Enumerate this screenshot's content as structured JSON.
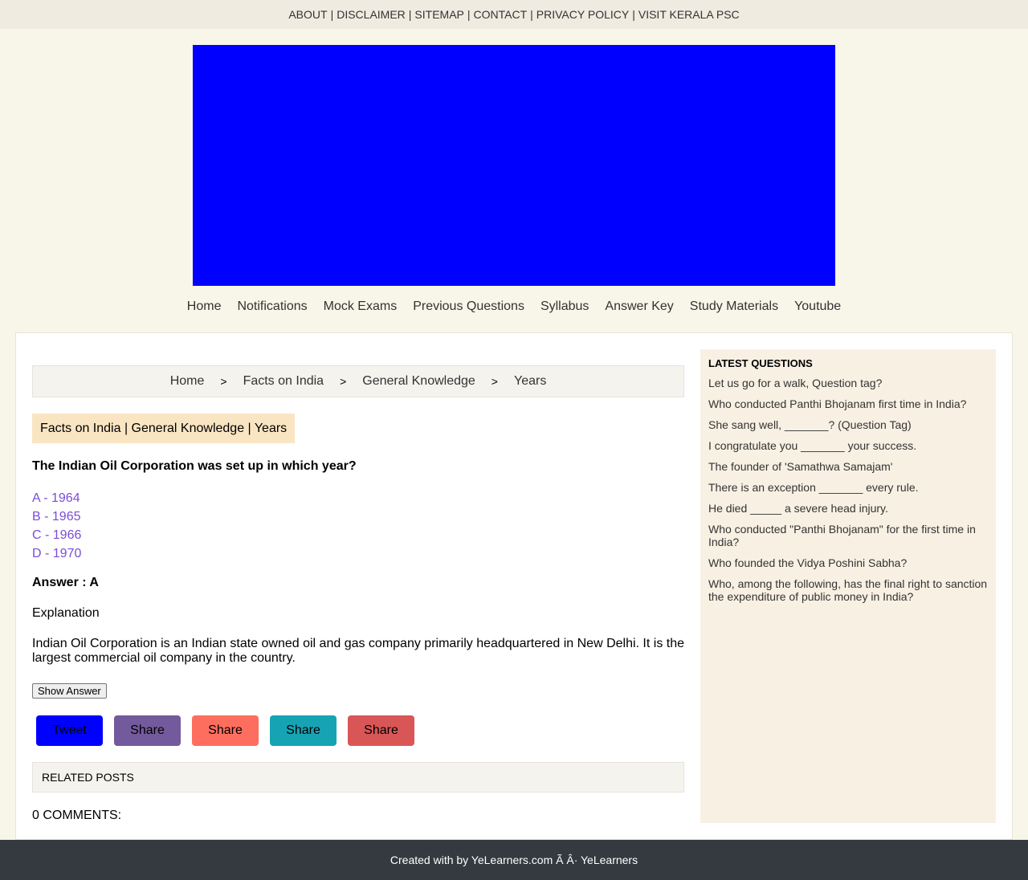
{
  "topbar": {
    "links": [
      "ABOUT",
      "DISCLAIMER",
      "SITEMAP",
      "CONTACT",
      "PRIVACY POLICY",
      "VISIT KERALA PSC"
    ],
    "separator": "|"
  },
  "banner": {
    "color": "#0000ff"
  },
  "nav": {
    "items": [
      "Home",
      "Notifications",
      "Mock Exams",
      "Previous Questions",
      "Syllabus",
      "Answer Key",
      "Study Materials",
      "Youtube"
    ]
  },
  "breadcrumb": {
    "items": [
      "Home",
      "Facts on India",
      "General Knowledge",
      "Years"
    ],
    "separator": ">"
  },
  "post": {
    "tagline": "Facts on India | General Knowledge | Years",
    "question": "The Indian Oil Corporation was set up in which year?",
    "options": [
      "A - 1964",
      "B - 1965",
      "C - 1966",
      "D - 1970"
    ],
    "answer": "Answer : A",
    "explanation_heading": "Explanation",
    "explanation": "Indian Oil Corporation is an Indian state owned oil and gas company primarily headquartered in New Delhi. It is the largest commercial oil company in the country.",
    "show_answer_label": "Show Answer"
  },
  "share": {
    "buttons": [
      {
        "label": "Tweet",
        "color": "#0000ff",
        "name": "tweet-button"
      },
      {
        "label": "Share",
        "color": "#735a9c",
        "name": "share-button-1"
      },
      {
        "label": "Share",
        "color": "#fe6e5e",
        "name": "share-button-2"
      },
      {
        "label": "Share",
        "color": "#16a4b4",
        "name": "share-button-3"
      },
      {
        "label": "Share",
        "color": "#d95656",
        "name": "share-button-4"
      }
    ]
  },
  "related": {
    "label": "RELATED POSTS"
  },
  "comments": {
    "label": "0 COMMENTS:"
  },
  "sidebar": {
    "title": "LATEST QUESTIONS",
    "items": [
      "Let us go for a walk, Question tag?",
      "Who conducted Panthi Bhojanam first time in India?",
      "She sang well, _______? (Question Tag)",
      "I congratulate you _______ your success.",
      "The founder of 'Samathwa Samajam'",
      "There is an exception _______ every rule.",
      "He died _____ a severe head injury.",
      "Who conducted \"Panthi Bhojanam\" for the first time in India?",
      "Who founded the Vidya Poshini Sabha?",
      "Who, among the following, has the final right to sanction the expenditure of public money in India?"
    ]
  },
  "footer": {
    "text": "Created with by YeLearners.com Ã    Â· YeLearners"
  }
}
